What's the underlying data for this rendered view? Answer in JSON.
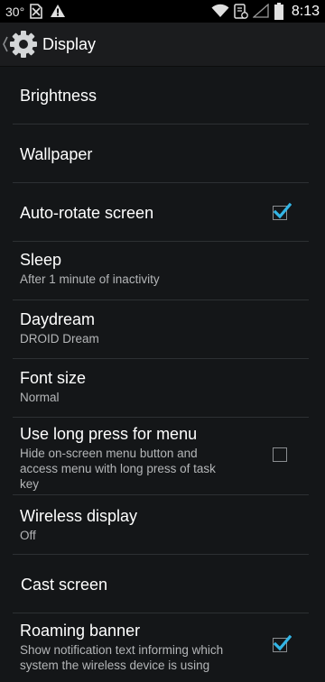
{
  "status_bar": {
    "temperature": "30°",
    "time": "8:13",
    "icons": [
      "no-sim-icon",
      "warning-icon",
      "wifi-icon",
      "nfc-icon",
      "no-signal-icon",
      "battery-icon"
    ]
  },
  "action_bar": {
    "title": "Display",
    "icon": "gear-icon"
  },
  "settings": [
    {
      "title": "Brightness"
    },
    {
      "title": "Wallpaper"
    },
    {
      "title": "Auto-rotate screen",
      "checked": true
    },
    {
      "title": "Sleep",
      "summary": "After 1 minute of inactivity"
    },
    {
      "title": "Daydream",
      "summary": "DROID Dream"
    },
    {
      "title": "Font size",
      "summary": "Normal"
    },
    {
      "title": "Use long press for menu",
      "summary": [
        "Hide on-screen menu button and",
        "access menu with long press of task",
        "key"
      ],
      "checked": false
    },
    {
      "title": "Wireless display",
      "summary": "Off"
    },
    {
      "title": "Cast screen"
    },
    {
      "title": "Roaming banner",
      "summary": [
        "Show notification text informing which",
        "system the wireless device is using"
      ],
      "checked": true
    }
  ],
  "colors": {
    "background": "#141618",
    "accent_check": "#33b5e5",
    "divider": "#2d3033",
    "summary_text": "#b4b6b8"
  }
}
